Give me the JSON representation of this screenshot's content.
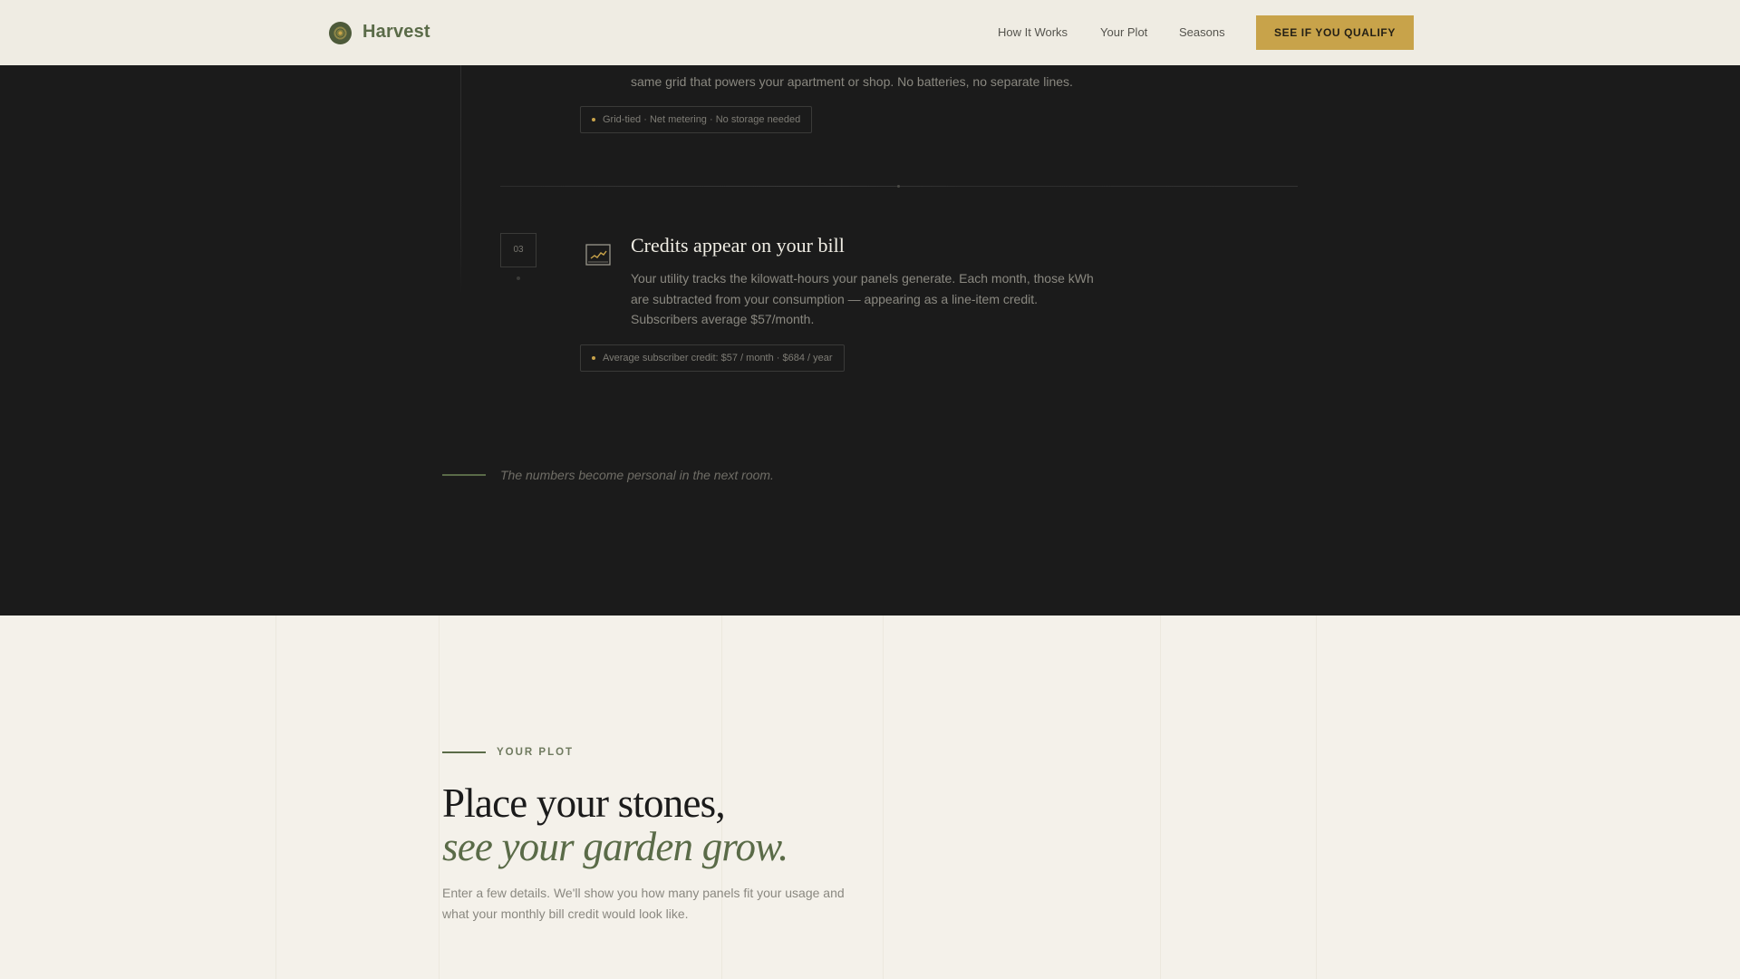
{
  "header": {
    "brand": "Harvest",
    "nav": [
      "How It Works",
      "Your Plot",
      "Seasons"
    ],
    "cta_label": "SEE IF YOU QUALIFY"
  },
  "steps": {
    "step2": {
      "body_partial": "same grid that powers your apartment or shop. No batteries, no separate lines.",
      "tag": "Grid-tied · Net metering · No storage needed"
    },
    "step3": {
      "number": "03",
      "title": "Credits appear on your bill",
      "body": "Your utility tracks the kilowatt-hours your panels generate. Each month, those kWh are subtracted from your consumption — appearing as a line-item credit. Subscribers average $57/month.",
      "tag": "Average subscriber credit: $57 / month · $684 / year"
    }
  },
  "transition_text": "The numbers become personal in the next room.",
  "plot": {
    "eyebrow": "YOUR PLOT",
    "headline_1": "Place your stones,",
    "headline_2": "see your garden grow.",
    "lede": "Enter a few details. We'll show you how many panels fit your usage and what your monthly bill credit would look like."
  },
  "colors": {
    "accent_gold": "#c8a34a",
    "brand_green": "#5a6b48",
    "dark_bg": "#1b1b1b",
    "light_bg": "#f4f1ea"
  },
  "icons": [
    "harvest-logo-icon",
    "line-chart-icon"
  ]
}
